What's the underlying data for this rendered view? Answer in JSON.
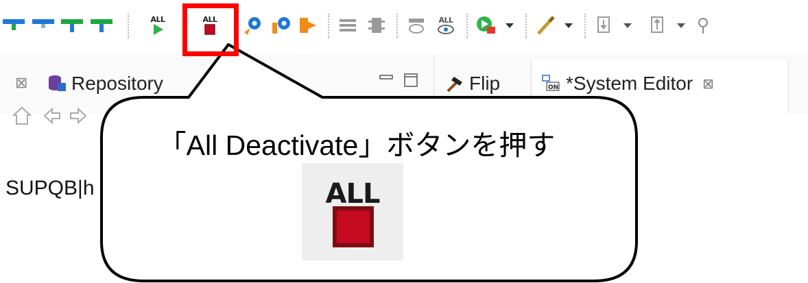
{
  "toolbar": {
    "all_run_label": "ALL",
    "all_deactivate_label": "ALL",
    "all_view_label": "ALL"
  },
  "tabs": {
    "repository_label": "Repository",
    "flip_label": "Flip",
    "system_editor_label": "*System Editor",
    "close_glyph": "⊠"
  },
  "content": {
    "partial_text": "SUPQB|h"
  },
  "callout": {
    "text": "「All Deactivate」ボタンを押す",
    "icon_label": "ALL"
  },
  "colors": {
    "highlight": "#ff0000",
    "stop_red": "#c40a21"
  }
}
